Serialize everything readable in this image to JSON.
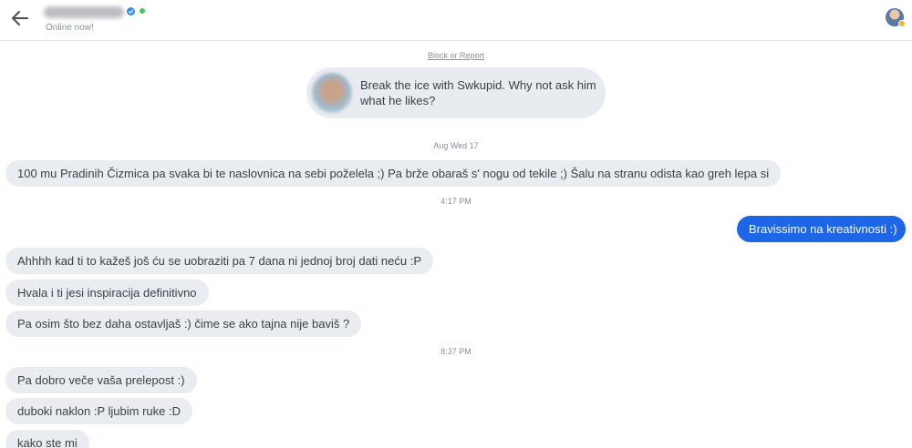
{
  "header": {
    "status": "Online now!"
  },
  "block_link": "Block or Report",
  "ice_breaker": "Break the ice with Swkupid. Why not ask him what he likes?",
  "timestamps": [
    "Aug Wed 17",
    "4:17 PM",
    "8:37 PM"
  ],
  "messages": [
    {
      "side": "in",
      "text": "100 mu Pradinih Čizmica pa svaka bi te naslovnica na sebi poželela ;) Pa brže obaraš s' nogu od tekile ;) Šalu na stranu odista kao greh lepa si"
    },
    {
      "side": "out",
      "text": "Bravissimo na kreativnosti :)"
    },
    {
      "side": "in",
      "text": "Ahhhh kad ti to kažeš još ću se uobraziti pa 7 dana ni jednoj broj dati neću :P"
    },
    {
      "side": "in",
      "text": "Hvala i ti jesi inspiracija definitivno"
    },
    {
      "side": "in",
      "text": "Pa osim što bez daha ostavljaš :) čime se ako tajna nije baviš ?"
    },
    {
      "side": "in",
      "text": "Pa dobro veče vaša prelepost :)"
    },
    {
      "side": "in",
      "text": "duboki naklon :P ljubim ruke :D"
    },
    {
      "side": "in",
      "text": "kako ste mi"
    }
  ],
  "colors": {
    "outgoing_bubble": "#1e66e8",
    "incoming_bubble": "#e9ecf0",
    "online": "#3ccc5a",
    "verified": "#2b8ff0"
  },
  "icons": [
    "back-arrow-icon",
    "verified-icon",
    "online-dot-icon",
    "user-avatar"
  ]
}
